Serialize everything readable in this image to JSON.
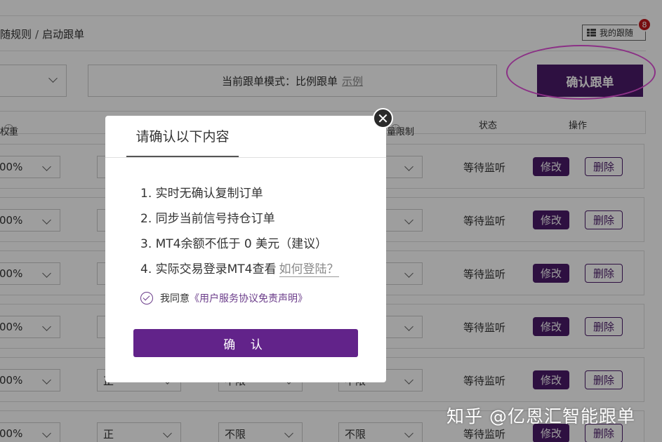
{
  "breadcrumb": {
    "parent": "随规则",
    "separator": "/",
    "current": "启动跟单"
  },
  "my_follow": {
    "label": "我的跟随",
    "badge": "8",
    "icon": "list-grid-icon"
  },
  "mode_bar": {
    "label": "当前跟单模式：比例跟单",
    "example_link": "示例"
  },
  "confirm_top_label": "确认跟单",
  "table": {
    "headers": {
      "weight": "权重",
      "limit": "量限制",
      "status": "状态",
      "actions": "操作"
    },
    "rows": [
      {
        "weight": "00%",
        "direction": "",
        "limit": "",
        "limit2": "",
        "status": "等待监听",
        "edit": "修改",
        "delete": "删除"
      },
      {
        "weight": "00%",
        "direction": "",
        "limit": "",
        "limit2": "",
        "status": "等待监听",
        "edit": "修改",
        "delete": "删除"
      },
      {
        "weight": "00%",
        "direction": "",
        "limit": "",
        "limit2": "",
        "status": "等待监听",
        "edit": "修改",
        "delete": "删除"
      },
      {
        "weight": "00%",
        "direction": "",
        "limit": "",
        "limit2": "",
        "status": "等待监听",
        "edit": "修改",
        "delete": "删除"
      },
      {
        "weight": "00%",
        "direction": "正",
        "limit": "不限",
        "limit2": "不限",
        "status": "等待监听",
        "edit": "修改",
        "delete": "删除"
      },
      {
        "weight": "00%",
        "direction": "正",
        "limit": "不限",
        "limit2": "不限",
        "status": "等待监听",
        "edit": "修改",
        "delete": "删除"
      }
    ]
  },
  "modal": {
    "title": "请确认以下内容",
    "items": [
      "1. 实时无确认复制订单",
      "2. 同步当前信号持仓订单",
      "3. MT4余额不低于 0 美元（建议）",
      "4. 实际交易登录MT4查看"
    ],
    "login_link": "如何登陆？",
    "agree_text": "我同意",
    "agreement_link": "《用户服务协议免责声明》",
    "confirm_label": "确 认",
    "close_symbol": "✕"
  },
  "watermark": "知乎 @亿恩汇智能跟单",
  "colors": {
    "brand_purple": "#4b1a69",
    "modal_button": "#62238a",
    "highlight_ellipse": "#e14fd8",
    "badge_red": "#c0161b"
  }
}
